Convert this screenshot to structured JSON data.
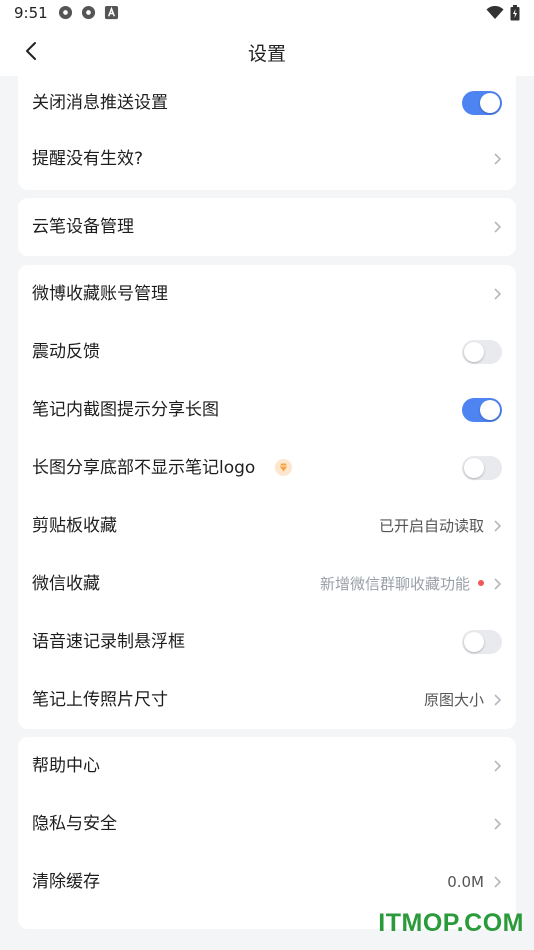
{
  "status": {
    "time": "9:51"
  },
  "header": {
    "title": "设置"
  },
  "group1": [
    {
      "label": "关闭消息推送设置",
      "type": "toggle",
      "on": true
    },
    {
      "label": "提醒没有生效?",
      "type": "link"
    }
  ],
  "group2": [
    {
      "label": "云笔设备管理",
      "type": "link"
    }
  ],
  "group3": [
    {
      "label": "微博收藏账号管理",
      "type": "link"
    },
    {
      "label": "震动反馈",
      "type": "toggle",
      "on": false
    },
    {
      "label": "笔记内截图提示分享长图",
      "type": "toggle",
      "on": true
    },
    {
      "label": "长图分享底部不显示笔记logo",
      "type": "toggle",
      "on": false,
      "icon": "diamond-icon"
    },
    {
      "label": "剪贴板收藏",
      "type": "link",
      "value": "已开启自动读取"
    },
    {
      "label": "微信收藏",
      "type": "link",
      "value": "新增微信群聊收藏功能"
    },
    {
      "label": "语音速记录制悬浮框",
      "type": "toggle",
      "on": false
    },
    {
      "label": "笔记上传照片尺寸",
      "type": "link",
      "value": "原图大小"
    }
  ],
  "group4": [
    {
      "label": "帮助中心",
      "type": "link"
    },
    {
      "label": "隐私与安全",
      "type": "link"
    },
    {
      "label": "清除缓存",
      "type": "link",
      "value": "0.0M"
    }
  ],
  "watermark": "ITMOP.COM",
  "colors": {
    "accent": "#4e83f2",
    "badge": "#f05858",
    "watermark": "#2a9a3a"
  }
}
